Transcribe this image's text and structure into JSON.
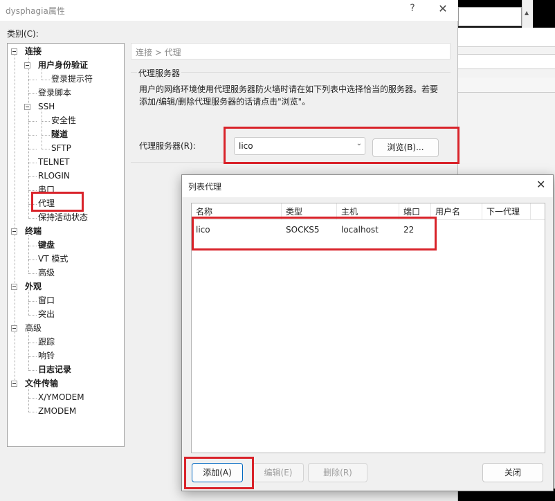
{
  "window": {
    "title": "dysphagia属性",
    "help_glyph": "?",
    "close_glyph": "✕"
  },
  "category_label": "类别(C):",
  "tree": [
    {
      "label": "连接",
      "bold": true
    },
    {
      "label": "用户身份验证",
      "bold": true
    },
    {
      "label": "登录提示符",
      "bold": false
    },
    {
      "label": "登录脚本",
      "bold": false
    },
    {
      "label": "SSH",
      "bold": false
    },
    {
      "label": "安全性",
      "bold": false
    },
    {
      "label": "隧道",
      "bold": true
    },
    {
      "label": "SFTP",
      "bold": false
    },
    {
      "label": "TELNET",
      "bold": false
    },
    {
      "label": "RLOGIN",
      "bold": false
    },
    {
      "label": "串口",
      "bold": false
    },
    {
      "label": "代理",
      "bold": false
    },
    {
      "label": "保持活动状态",
      "bold": false
    },
    {
      "label": "终端",
      "bold": true
    },
    {
      "label": "键盘",
      "bold": true
    },
    {
      "label": "VT 模式",
      "bold": false
    },
    {
      "label": "高级",
      "bold": false
    },
    {
      "label": "外观",
      "bold": true
    },
    {
      "label": "窗口",
      "bold": false
    },
    {
      "label": "突出",
      "bold": false
    },
    {
      "label": "高级",
      "bold": false
    },
    {
      "label": "跟踪",
      "bold": false
    },
    {
      "label": "响铃",
      "bold": false
    },
    {
      "label": "日志记录",
      "bold": true
    },
    {
      "label": "文件传输",
      "bold": true
    },
    {
      "label": "X/YMODEM",
      "bold": false
    },
    {
      "label": "ZMODEM",
      "bold": false
    }
  ],
  "panel": {
    "breadcrumb": "连接 > 代理",
    "group_title": "代理服务器",
    "description": "用户的网络环境使用代理服务器防火墙时请在如下列表中选择恰当的服务器。若要添加/编辑/删除代理服务器的话请点击\"浏览\"。",
    "proxy_label": "代理服务器(R):",
    "proxy_value": "lico",
    "browse_button": "浏览(B)..."
  },
  "list_dialog": {
    "title": "列表代理",
    "close_glyph": "✕",
    "columns": [
      "名称",
      "类型",
      "主机",
      "端口",
      "用户名",
      "下一代理"
    ],
    "rows": [
      {
        "name": "lico",
        "type": "SOCKS5",
        "host": "localhost",
        "port": "22",
        "user": "",
        "next": ""
      }
    ],
    "buttons": {
      "add": "添加(A)",
      "edit": "编辑(E)",
      "delete": "删除(R)",
      "close": "关闭"
    }
  },
  "colors": {
    "highlight": "#d9232a",
    "accent": "#0067c0"
  }
}
